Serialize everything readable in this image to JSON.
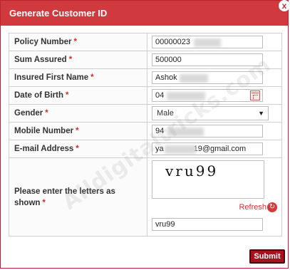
{
  "dialog": {
    "title": "Generate Customer ID",
    "close_glyph": "x",
    "submit_label": "Submit"
  },
  "watermark": "Alldigitaltricks.com",
  "form": {
    "required_mark": "*",
    "policy_number": {
      "label": "Policy Number",
      "value": "00000023"
    },
    "sum_assured": {
      "label": "Sum Assured",
      "value": "500000"
    },
    "first_name": {
      "label": "Insured First Name",
      "value": "Ashok"
    },
    "dob": {
      "label": "Date of Birth",
      "value": "04",
      "icon": "calendar-icon"
    },
    "gender": {
      "label": "Gender",
      "selected": "Male",
      "icon": "dropdown-arrow-icon"
    },
    "mobile": {
      "label": "Mobile Number",
      "value": "94"
    },
    "email": {
      "label": "E-mail Address",
      "value_prefix": "ya",
      "value_suffix": "19@gmail.com"
    },
    "captcha": {
      "label": "Please enter the letters as shown",
      "image_text": "vru99",
      "refresh_label": "Refresh",
      "refresh_icon": "refresh-icon",
      "input_value": "vru99"
    }
  },
  "colors": {
    "titlebar": "#d03a3f",
    "submit": "#a3141f",
    "required": "#d22b2b"
  }
}
